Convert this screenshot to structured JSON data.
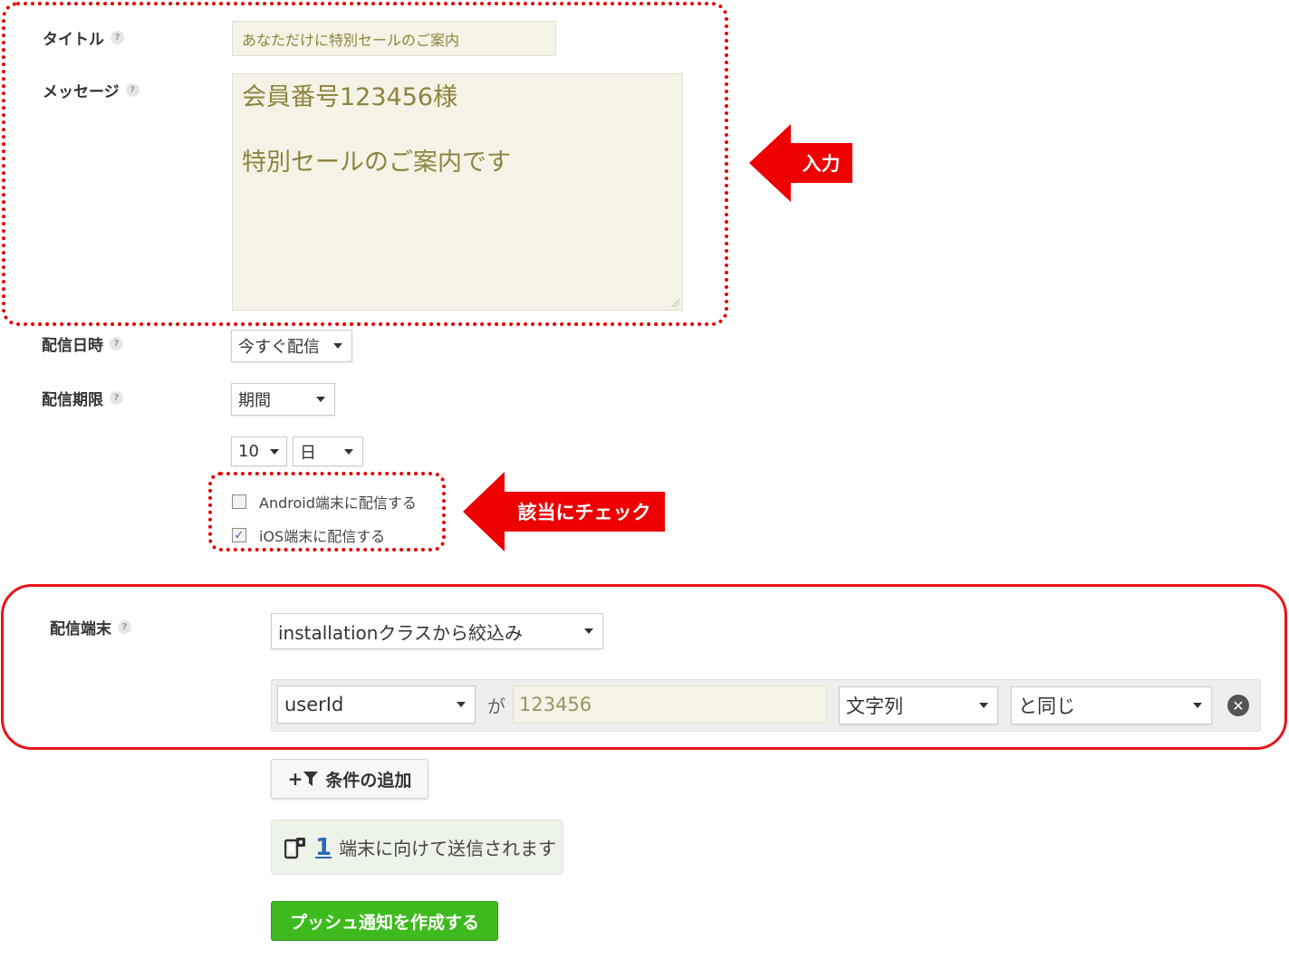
{
  "form": {
    "title": {
      "label": "タイトル",
      "help": "?",
      "value": "あなただけに特別セールのご案内"
    },
    "message": {
      "label": "メッセージ",
      "help": "?",
      "line1": "会員番号123456様",
      "line2": "特別セールのご案内です"
    },
    "delivery_time": {
      "label": "配信日時",
      "help": "?",
      "selected": "今すぐ配信"
    },
    "delivery_limit": {
      "label": "配信期限",
      "help": "?",
      "selected": "期間",
      "amount": "10",
      "unit": "日"
    },
    "platforms": {
      "android_label": "Android端末に配信する",
      "android_checked": false,
      "ios_label": "iOS端末に配信する",
      "ios_checked": true,
      "check_mark": "✓"
    },
    "target": {
      "label": "配信端末",
      "help": "?",
      "selected": "installationクラスから絞込み",
      "condition": {
        "field": "userId",
        "connector": "が",
        "value": "123456",
        "type": "文字列",
        "operator": "と同じ",
        "remove_symbol": "✕"
      }
    },
    "add_condition_label": "条件の追加",
    "add_condition_symbol": "+",
    "device_count": {
      "count": "1",
      "text": "端末に向けて送信されます"
    },
    "create_button": "プッシュ通知を作成する"
  },
  "annotations": {
    "input_callout": "入力",
    "check_callout": "該当にチェック",
    "color": "#ee0000"
  }
}
